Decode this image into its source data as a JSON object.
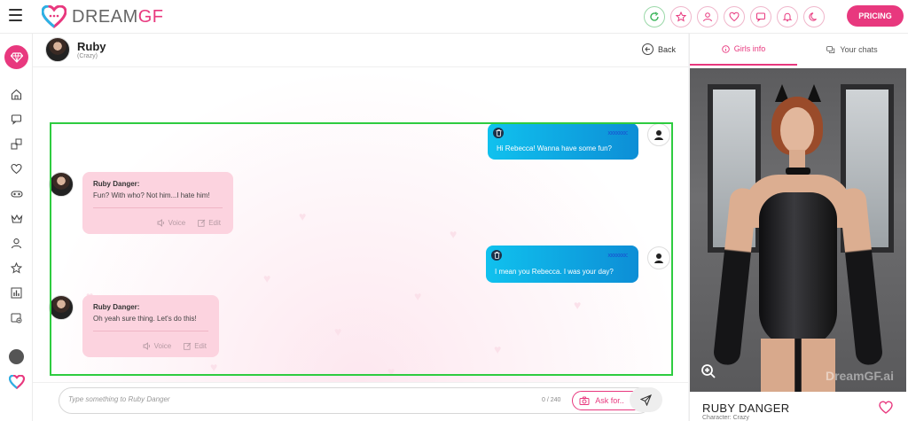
{
  "app": {
    "brand_left": "DREAM",
    "brand_right": "GF",
    "pricing_label": "PRICING"
  },
  "top_icons": [
    "refresh-icon",
    "star-icon",
    "user-icon",
    "heart-icon",
    "chat-icon",
    "bell-icon",
    "moon-icon"
  ],
  "sidebar": {
    "items": [
      "home-icon",
      "chat-icon",
      "gallery-icon",
      "heart-icon",
      "mask-icon",
      "crown-icon",
      "user-icon",
      "star-icon",
      "stats-icon",
      "image-icon"
    ]
  },
  "chat": {
    "header": {
      "name": "Ruby",
      "subtitle": "(Crazy)",
      "back_label": "Back"
    },
    "messages": [
      {
        "role": "user",
        "blur": "xxxxxxx:",
        "text": "Hi Rebecca! Wanna have some fun?"
      },
      {
        "role": "ai",
        "name": "Ruby Danger:",
        "text": "Fun? With who? Not him...I hate him!",
        "voice": "Voice",
        "edit": "Edit"
      },
      {
        "role": "user",
        "blur": "xxxxxxx:",
        "text": "I mean you Rebecca. I was your day?"
      },
      {
        "role": "ai",
        "name": "Ruby Danger:",
        "text": "Oh yeah sure thing. Let's do this!",
        "voice": "Voice",
        "edit": "Edit"
      }
    ],
    "input": {
      "placeholder": "Type something to Ruby Danger",
      "counter": "0 / 240",
      "ask_label": "Ask for.."
    }
  },
  "panel": {
    "tabs": {
      "girls_info": "Girls info",
      "your_chats": "Your chats"
    },
    "watermark": "DreamGF.ai",
    "character_name": "RUBY DANGER",
    "character_sub": "Character: Crazy"
  },
  "colors": {
    "accent": "#e8387e",
    "user_bubble": "#0fb0e6",
    "ai_bubble": "#fcd3df",
    "highlight": "#2ecc40"
  }
}
